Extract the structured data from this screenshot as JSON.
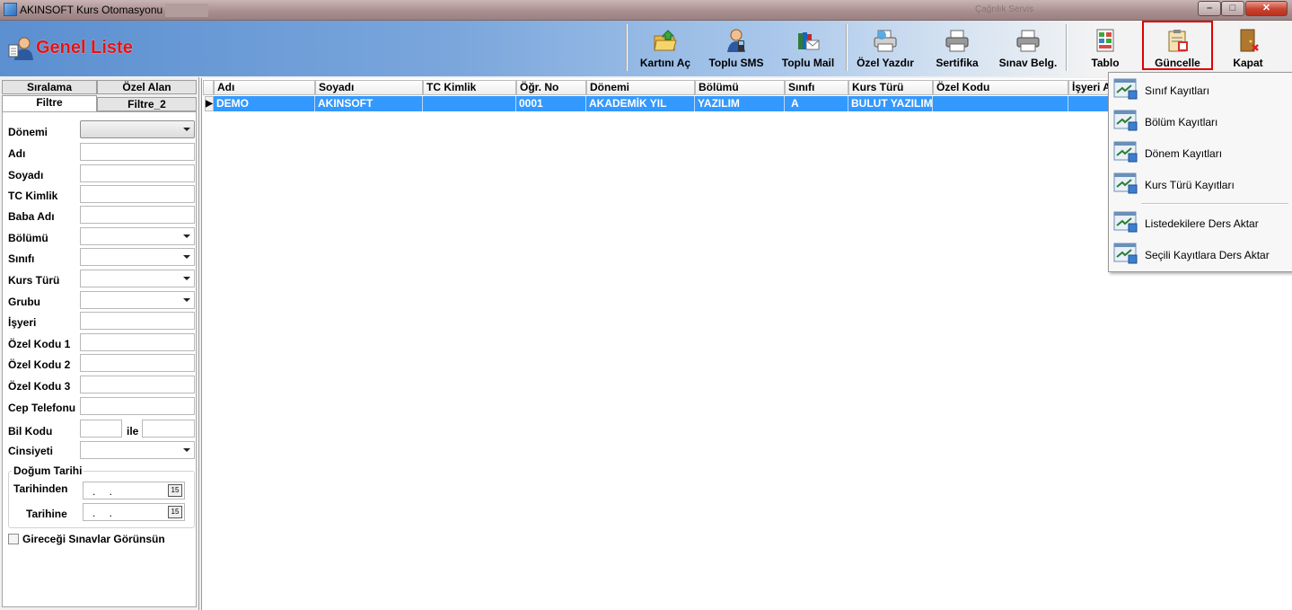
{
  "window": {
    "title": "AKINSOFT Kurs Otomasyonu s",
    "ghost_text": "Çağrılık Servis",
    "minimize": "–",
    "maximize": "□",
    "close": "✕"
  },
  "header": {
    "title": "Genel Liste"
  },
  "toolbar": {
    "buttons": [
      {
        "label": "Kartını Aç",
        "icon": "folder-open-icon"
      },
      {
        "label": "Toplu SMS",
        "icon": "phone-person-icon"
      },
      {
        "label": "Toplu Mail",
        "icon": "mail-books-icon"
      },
      {
        "label": "Özel Yazdır",
        "icon": "custom-print-icon"
      },
      {
        "label": "Sertifika",
        "icon": "printer-icon"
      },
      {
        "label": "Sınav Belg.",
        "icon": "printer-icon"
      },
      {
        "label": "Tablo",
        "icon": "table-icon"
      },
      {
        "label": "Güncelle",
        "icon": "update-clipboard-icon",
        "highlighted": true
      },
      {
        "label": "Kapat",
        "icon": "door-exit-icon"
      }
    ]
  },
  "left_panel": {
    "tabs": {
      "siralama": "Sıralama",
      "ozel_alan": "Özel Alan",
      "filtre": "Filtre",
      "filtre_2": "Filtre_2"
    },
    "fields": {
      "donemi": "Dönemi",
      "adi": "Adı",
      "soyadi": "Soyadı",
      "tc_kimlik": "TC Kimlik",
      "baba_adi": "Baba Adı",
      "bolumu": "Bölümü",
      "sinifi": "Sınıfı",
      "kurs_turu": "Kurs Türü",
      "grubu": "Grubu",
      "isyeri": "İşyeri",
      "ozel_kodu_1": "Özel Kodu 1",
      "ozel_kodu_2": "Özel Kodu 2",
      "ozel_kodu_3": "Özel Kodu 3",
      "cep_telefonu": "Cep Telefonu",
      "bil_kodu": "Bil Kodu",
      "ile": "ile",
      "cinsiyeti": "Cinsiyeti"
    },
    "dogum_tarihi": {
      "title": "Doğum Tarihi",
      "tarihinden": "Tarihinden",
      "tarihine": "Tarihine",
      "date_placeholder": ". .",
      "calendar_label": "15"
    },
    "checkbox_label": "Gireceği Sınavlar Görünsün"
  },
  "grid": {
    "columns": [
      "Adı",
      "Soyadı",
      "TC Kimlik",
      "Öğr. No",
      "Dönemi",
      "Bölümü",
      "Sınıfı",
      "Kurs Türü",
      "Özel Kodu",
      "İşyeri A"
    ],
    "rows": [
      [
        "DEMO",
        "AKINSOFT",
        "",
        "0001",
        "AKADEMİK YIL",
        "YAZILIM",
        "A",
        "BULUT YAZILIM",
        "",
        ""
      ]
    ],
    "row_indicator": "▶"
  },
  "dropdown_menu": {
    "items": [
      {
        "label": "Sınıf Kayıtları"
      },
      {
        "label": "Bölüm Kayıtları"
      },
      {
        "label": "Dönem Kayıtları"
      },
      {
        "label": "Kurs Türü Kayıtları"
      },
      {
        "label": "Listedekilere Ders Aktar"
      },
      {
        "label": "Seçili Kayıtlara Ders Aktar"
      }
    ]
  },
  "colors": {
    "selection": "#3399ff",
    "title_red": "#e51212",
    "highlight_border": "#e00000"
  }
}
